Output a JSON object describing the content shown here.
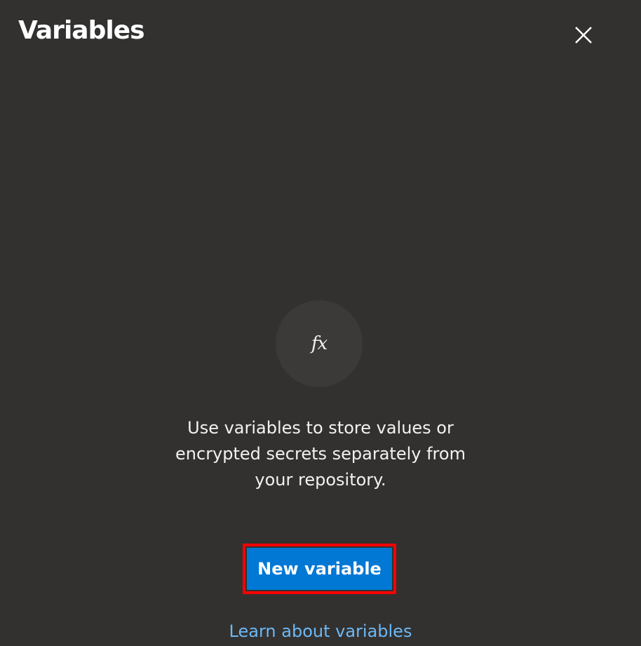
{
  "panel": {
    "title": "Variables",
    "close_icon": "close-icon"
  },
  "empty_state": {
    "icon": "function-fx-icon",
    "icon_glyph": "fx",
    "description": "Use variables to store values or encrypted secrets separately from your repository.",
    "primary_button_label": "New variable",
    "learn_link_label": "Learn about variables"
  },
  "colors": {
    "background": "#323130",
    "accent": "#0078d4",
    "link": "#6cb8f6",
    "highlight": "#ff0000"
  }
}
